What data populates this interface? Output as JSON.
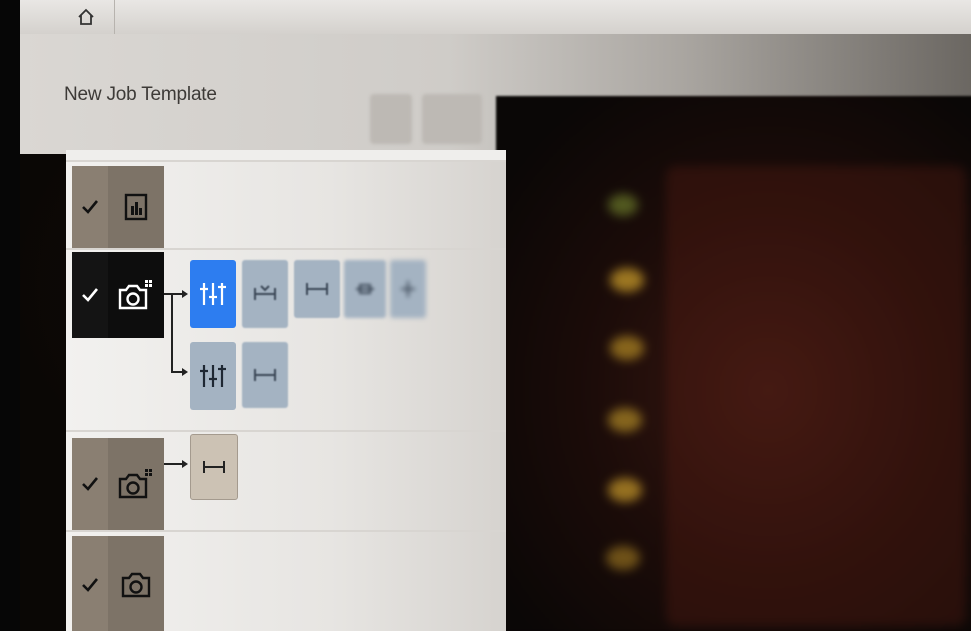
{
  "header": {
    "home_icon": "home-icon",
    "title": "New Job Template"
  },
  "rows": [
    {
      "checked": true,
      "icon": "report-icon",
      "style": "brown",
      "tools": []
    },
    {
      "checked": true,
      "icon": "camera-multi-icon",
      "style": "black",
      "tools": [
        {
          "icon": "adjust-sliders-icon",
          "selected": true
        },
        {
          "icon": "measure-mark-icon",
          "selected": false
        },
        {
          "icon": "measure-icon",
          "selected": false
        },
        {
          "icon": "measure-box-icon",
          "selected": false
        },
        {
          "icon": "tool-icon",
          "selected": false
        },
        {
          "icon": "adjust-sliders-icon",
          "selected": false
        },
        {
          "icon": "measure-icon",
          "selected": false
        }
      ]
    },
    {
      "checked": true,
      "icon": "camera-multi-icon",
      "style": "brown",
      "tools": [
        {
          "icon": "measure-icon",
          "selected": false
        }
      ]
    },
    {
      "checked": true,
      "icon": "camera-icon",
      "style": "brown",
      "tools": []
    }
  ],
  "colors": {
    "accent_blue": "#2d7df0",
    "tile_grey": "#a4b3c2",
    "row_brown": "#7d7367",
    "row_black": "#0d0d0d"
  }
}
